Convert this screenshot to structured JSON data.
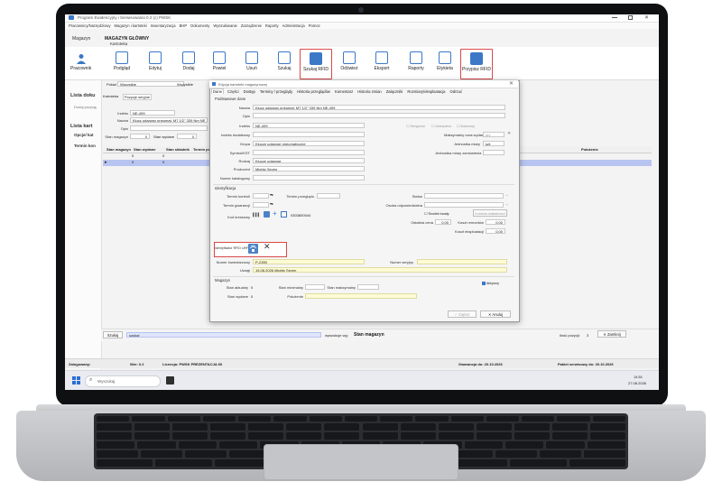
{
  "app": {
    "title": "Program Ewidencyjny i Serwisowania  0.2   (c) PWSK",
    "menu": [
      "Pracownicy/Narzędziowy",
      "Magazyn i kartoteki",
      "Inwentaryzacja",
      "BHP",
      "Dokumenty",
      "Wyszukiwanie",
      "Zarządzenie",
      "Raporty",
      "Administracja",
      "Pomoc"
    ],
    "left_section": "Magazyn",
    "magazyn_title": "MAGAZYN GŁÓWNY",
    "window_label": "Kartoteka",
    "left_pane_item": "Pracownik"
  },
  "toolbar": {
    "buttons": [
      {
        "label": "Podgląd",
        "icon": "preview-icon"
      },
      {
        "label": "Edytuj",
        "icon": "pencil-icon"
      },
      {
        "label": "Dodaj",
        "icon": "plus-icon"
      },
      {
        "label": "Powiel",
        "icon": "duplicate-icon"
      },
      {
        "label": "Usuń",
        "icon": "trash-icon"
      },
      {
        "label": "Szukaj",
        "icon": "search-icon"
      },
      {
        "label": "Szukaj RFID",
        "icon": "rfid-icon"
      },
      {
        "label": "Odśwież",
        "icon": "refresh-icon"
      },
      {
        "label": "Eksport",
        "icon": "export-icon"
      },
      {
        "label": "Raporty",
        "icon": "reports-icon"
      },
      {
        "label": "Etykieta",
        "icon": "label-icon"
      },
      {
        "label": "Przypisz RFID",
        "icon": "rfid-assign-icon"
      }
    ]
  },
  "list": {
    "heading": "Lista doku",
    "subheading": "Dodaj pozycję",
    "tabs": [
      "Kartoteka",
      "Pozycje seryjne"
    ],
    "filter_label": "Pokaż",
    "filter_value": "Wszystkie",
    "filter_check": "Wszystkie",
    "card_heading": "Lista kart",
    "card_sub": "Opcje/ kat",
    "term_label": "Termin kon",
    "index_label": "Indeks",
    "index_value": "NE-499",
    "name_label": "Nazwa",
    "name_value": "Klucz udarowy pneumat. M7 1/2\" 339 Nm NE",
    "desc_label": "Opis",
    "stan_mag_label": "Stan magazyn",
    "stan_mag_value": "0",
    "stan_wyd_label": "Stan wydane",
    "stan_wyd_value": "0",
    "columns": [
      "Stan magazyn",
      "Stan wydane",
      "Stan składnik",
      "Termin pop",
      "Położenie"
    ],
    "row_values": [
      "0",
      "0"
    ],
    "search_label": "Szukaj",
    "search_value": "szukaj",
    "summary_prefix": "wyszukuje wg:",
    "summary_value": "Stan magazyn",
    "count_label": "Ilość pozycji:",
    "count_value": "3",
    "close_label": "Zamknij"
  },
  "dialog": {
    "title": "Edycja kartoteki magazynowej",
    "tabs": [
      "Dane",
      "Części",
      "Dostęp",
      "Terminy / przeglądy",
      "Historia przeglądów",
      "Komentarz",
      "Historia zmian",
      "Załączniki",
      "Rozmiary/eksploatacja",
      "Odrzuć"
    ],
    "section_basic": "Podstawowe dane",
    "name_label": "Nazwa",
    "name_value": "Klucz udarowy pneumat. M7 1/2\" 339 Nm NE-499",
    "opis_label": "Opis",
    "index_label": "Indeks",
    "index_value": "NE-499",
    "chk_seryjne": "Seryjność",
    "chk_ubezpiecz": "Ubezpiecz.",
    "chk_ilosc": "Ilościowy",
    "jedn_label": "Indeks dodatkowy",
    "grupa_label": "Grupa",
    "grupa_value": "Klucze udarowe pneumatyczne",
    "symbol_label": "Symbol/KST",
    "rodzaj_label": "Rodzaj",
    "rodzaj_value": "Klucze udarowe",
    "producent_label": "Producent",
    "producent_value": "Mighty Seven",
    "numer_kat_label": "Numer katalogowy",
    "max_czas_label": "Maksymalny czas wydania",
    "max_czas_value": "dni",
    "jedn_miary_label": "Jednostka miary",
    "jedn_miary_value": "szt.",
    "jedn_zam_label": "Jednostka miary zamówienia",
    "section_ident": "Identyfikacja",
    "termin_konc_label": "Termin kontroli",
    "termin_przeg_label": "Termin przeglądu",
    "termin_gwar_label": "Termin gwarancji",
    "kod_label": "Kod kreskowy",
    "kod_value": "0303800044",
    "rfid_label": "Identyfikator RFID UHF",
    "inv_label": "Numer inwentarzowy",
    "inv_value": "P-2359",
    "uwagi_label": "Uwagi",
    "uwagi_value": "15.08.2026 Mighty Seven",
    "status_label": "Status",
    "osoba_label": "Osoba odpowiedzialna",
    "srodek_label": "Środek trwały",
    "kontrola_label": "Kontrola dokładności",
    "cena_label": "Ostatnia cena",
    "cena_value": "0,00",
    "koszt_rem_label": "Koszt remontów",
    "koszt_rem_value": "0,00",
    "koszt_eks_label": "Koszt eksploatacji",
    "koszt_eks_value": "0,00",
    "serial_label": "Numer seryjny",
    "section_mag": "Magazyn",
    "stan_akt_label": "Stan aktualny",
    "stan_akt_value": "0",
    "stan_min_label": "Stan minimalny",
    "stan_max_label": "Stan maksymalny",
    "stan_wyd_label": "Stan wydane",
    "stan_wyd_value": "0",
    "polozenie_label": "Położenie",
    "aktywny_label": "Aktywny",
    "zapisz_label": "Zapisz",
    "anuluj_label": "Anuluj"
  },
  "status": {
    "zalogowany_label": "Zalogowany:",
    "wer": "Wer: 0.2",
    "licencja": "Licencja: PWSK PREZENTACJA 60",
    "gwarancja": "Gwarancja do: 20.10.2026",
    "pakiet": "Pakiet serwisowy do: 20.10.2026"
  },
  "taskbar": {
    "search_placeholder": "Wyszukaj",
    "time": "14:51",
    "date": "27.08.2026"
  }
}
